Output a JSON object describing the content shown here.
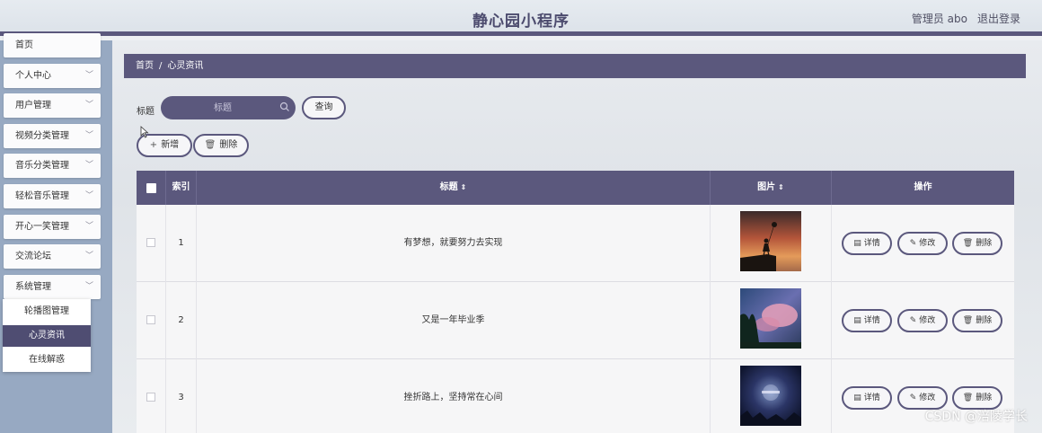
{
  "header": {
    "title": "静心园小程序",
    "user": "管理员 abo",
    "logout": "退出登录"
  },
  "sidebar": {
    "items": [
      {
        "label": "首页"
      },
      {
        "label": "个人中心"
      },
      {
        "label": "用户管理"
      },
      {
        "label": "视频分类管理"
      },
      {
        "label": "音乐分类管理"
      },
      {
        "label": "轻松音乐管理"
      },
      {
        "label": "开心一笑管理"
      },
      {
        "label": "交流论坛"
      },
      {
        "label": "系统管理"
      }
    ],
    "submenu": [
      {
        "label": "轮播图管理"
      },
      {
        "label": "心灵资讯",
        "active": true
      },
      {
        "label": "在线解惑"
      }
    ]
  },
  "breadcrumb": {
    "home": "首页",
    "separator": "/",
    "current": "心灵资讯"
  },
  "search": {
    "label": "标题",
    "placeholder": "标题",
    "query_button": "查询"
  },
  "actions": {
    "add": "新增",
    "delete": "删除"
  },
  "table": {
    "headers": {
      "index": "索引",
      "title": "标题",
      "image": "图片",
      "operation": "操作"
    },
    "rows": [
      {
        "index": "1",
        "title": "有梦想，就要努力去实现"
      },
      {
        "index": "2",
        "title": "又是一年毕业季"
      },
      {
        "index": "3",
        "title": "挫折路上，坚持常在心间"
      }
    ],
    "row_buttons": {
      "detail": "详情",
      "edit": "修改",
      "delete": "删除"
    }
  },
  "watermark": "CSDN @涪陵学长",
  "colors": {
    "primary": "#5b587d",
    "sidebar": "#97a9c2"
  }
}
